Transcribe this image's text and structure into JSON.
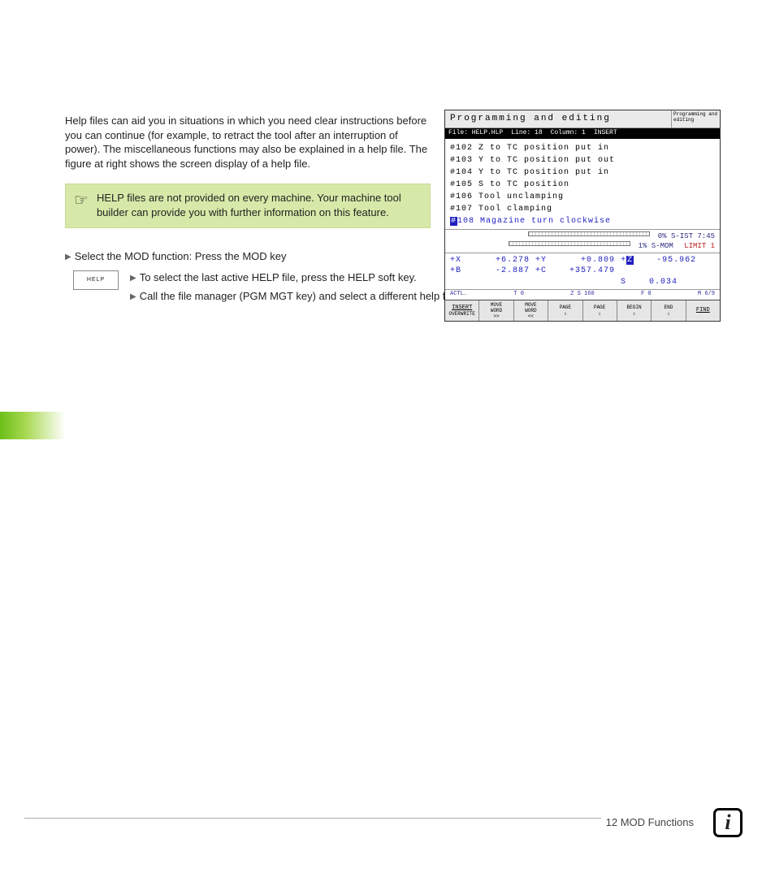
{
  "intro": "Help files can aid you in situations in which you need clear instructions before you can continue (for example, to retract the tool after an interruption of power). The miscellaneous functions may also be explained in a help file. The figure at right shows the screen display of a help file.",
  "note": "HELP files are not provided on every machine. Your machine tool builder can provide you with further information on this feature.",
  "step1": "Select the MOD function: Press the MOD key",
  "softkey_label": "HELP",
  "sub1": "To select the last active HELP file, press the HELP soft key.",
  "sub2": "Call the file manager (PGM MGT key) and select a different help file, if necessary.",
  "footer": "12 MOD Functions",
  "screen": {
    "title": "Programming and editing",
    "side_mode": "Programming and editing",
    "file": "File: HELP.HLP",
    "line": "Line: 18",
    "column": "Column: 1",
    "mode": "INSERT",
    "listing": [
      "#102  Z  to  TC  position  put  in",
      "#103  Y  to  TC  position  put  out",
      "#104  Y  to  TC  position  put  in",
      "#105  S  to  TC  position",
      "#106  Tool  unclamping",
      "#107  Tool  clamping"
    ],
    "listing_selected": "108  Magazine  turn  clockwise",
    "perc0": "0% S-IST 7:45",
    "perc1": "1% S-MOM",
    "limit": "LIMIT 1",
    "coords_l1_a": "+X      +6.278",
    "coords_l1_b": "+Y      +0.809",
    "coords_l1_c": "+",
    "coords_l1_z": "Z",
    "coords_l1_d": "    -95.962",
    "coords_l2": "+B      -2.887 +C    +357.479",
    "coords_l3": "                              S    0.034",
    "stat": {
      "a": "ACTL.",
      "t": "T 0",
      "z": "Z S 160",
      "f": "F 0",
      "m": "M 6/9"
    },
    "softkeys": [
      {
        "l1": "INSERT",
        "l2": "OVERWRITE"
      },
      {
        "l1": "MOVE",
        "l2": "WORD",
        "l3": ">>"
      },
      {
        "l1": "MOVE",
        "l2": "WORD",
        "l3": "<<"
      },
      {
        "l1": "PAGE",
        "arrow": "⇧"
      },
      {
        "l1": "PAGE",
        "arrow": "⇩"
      },
      {
        "l1": "BEGIN",
        "arrow": "⇧"
      },
      {
        "l1": "END",
        "arrow": "⇩"
      },
      {
        "l1": "FIND"
      }
    ]
  }
}
